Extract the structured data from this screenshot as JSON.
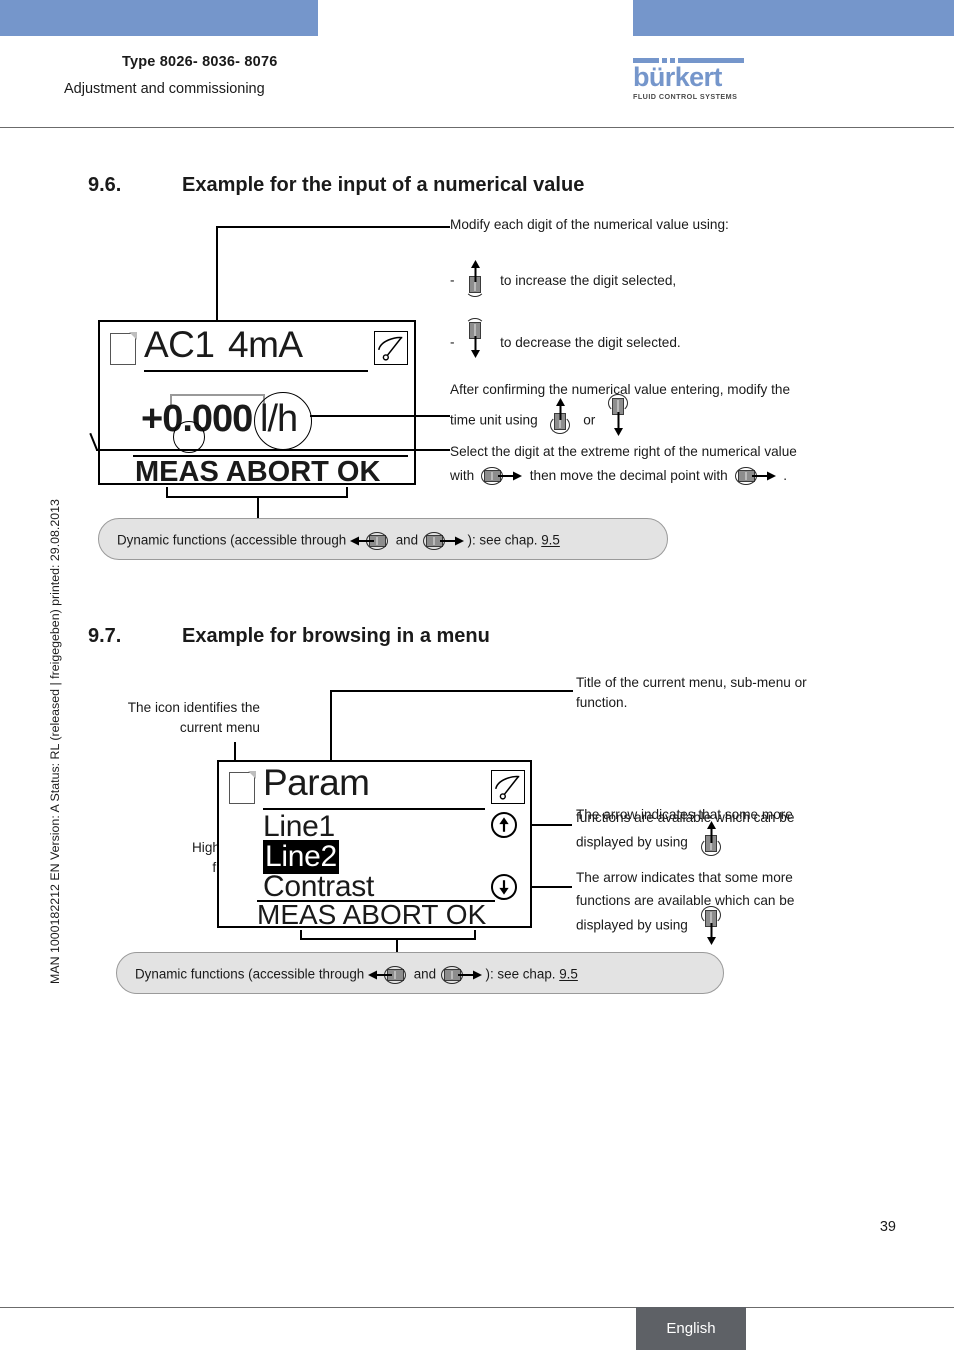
{
  "header": {
    "doc_type": "Type 8026- 8036- 8076",
    "doc_subtitle": "Adjustment and commissioning",
    "logo_wordmark": "bürkert",
    "logo_tagline": "FLUID CONTROL SYSTEMS",
    "accent_color": "#7596cb"
  },
  "sidebar": {
    "meta": "MAN  1000182212  EN  Version: A  Status: RL (released | freigegeben)  printed: 29.08.2013"
  },
  "section96": {
    "number": "9.6.",
    "title": "Example for the input of a numerical value",
    "display": {
      "title": "AC1",
      "value_unit_header": "4mA",
      "value": "+0.000",
      "unit": "l/h",
      "softkeys": "MEAS ABORT  OK",
      "page_icon": "document-icon",
      "gauge_icon": "gauge-icon"
    },
    "annotations": {
      "modify_intro": "Modify each digit of the numerical value using:",
      "increase": "to increase the digit selected,",
      "decrease": "to decrease the digit selected.",
      "after_confirm_l1": "After confirming the numerical value entering, modify the",
      "after_confirm_l2_a": "time unit using",
      "after_confirm_l2_or": "or",
      "select_digit_l1": "Select the digit at the extreme right of the numerical value",
      "select_digit_l2_a": "with",
      "select_digit_l2_b": "then move the decimal point with",
      "select_digit_l2_end": "."
    },
    "callout": {
      "prefix": "Dynamic functions (accessible through",
      "mid": "and",
      "suffix": "): see chap.",
      "link": "9.5"
    }
  },
  "section97": {
    "number": "9.7.",
    "title": "Example for browsing in a menu",
    "display": {
      "title": "Param",
      "lines": [
        "Line1",
        "Line2",
        "Contrast"
      ],
      "highlighted_index": 1,
      "softkeys": "MEAS ABORT OK",
      "page_icon": "document-icon",
      "gauge_icon": "gauge-icon",
      "up_arrow_icon": "arrow-up-circle-icon",
      "down_arrow_icon": "arrow-down-circle-icon"
    },
    "annotations": {
      "icon_identifies_l1": "The icon identifies the",
      "icon_identifies_l2": "current menu",
      "title_of_menu_l1": "Title of the current menu, sub-menu or",
      "title_of_menu_l2": "function.",
      "highlighted_l1": "Highlighted",
      "highlighted_l2": "function",
      "arrow_up_l1": "The arrow indicates that some more",
      "arrow_up_l2": "functions are available which can be",
      "arrow_up_l3": "displayed by using",
      "arrow_down_l1": "The arrow indicates that some more",
      "arrow_down_l2": "functions are available which can be",
      "arrow_down_l3": "displayed by using"
    },
    "callout": {
      "prefix": "Dynamic functions (accessible through",
      "mid": "and",
      "suffix": "): see chap.",
      "link": "9.5"
    }
  },
  "footer": {
    "page_number": "39",
    "language": "English",
    "language_bg": "#5e6166"
  }
}
